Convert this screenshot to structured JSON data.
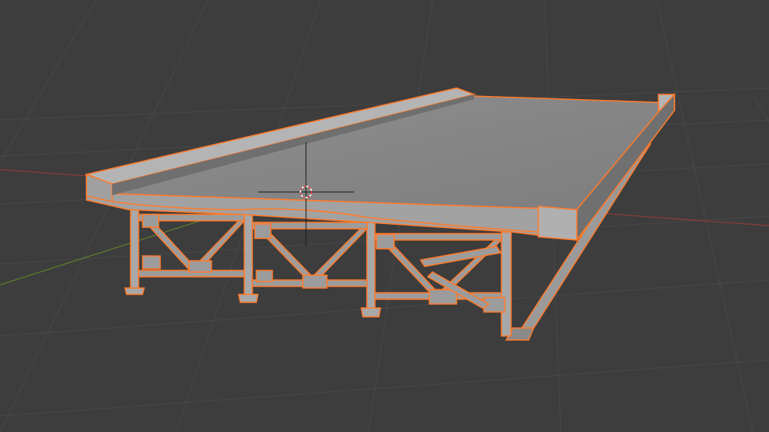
{
  "viewport": {
    "background": "#3d3d3d",
    "grid_color": "#4a4a4a",
    "x_axis_color": "#a04040",
    "y_axis_color": "#6b8a2e",
    "selection_outline_color": "#ff7a2a",
    "deck_top_color": "#8a8a8a",
    "deck_side_color": "#a8a8a8",
    "steel_color": "#a9a9a9"
  },
  "scene": {
    "object": "bridge-deck-with-girders",
    "selected": true,
    "cursor_icon": "3d-cursor-icon"
  }
}
